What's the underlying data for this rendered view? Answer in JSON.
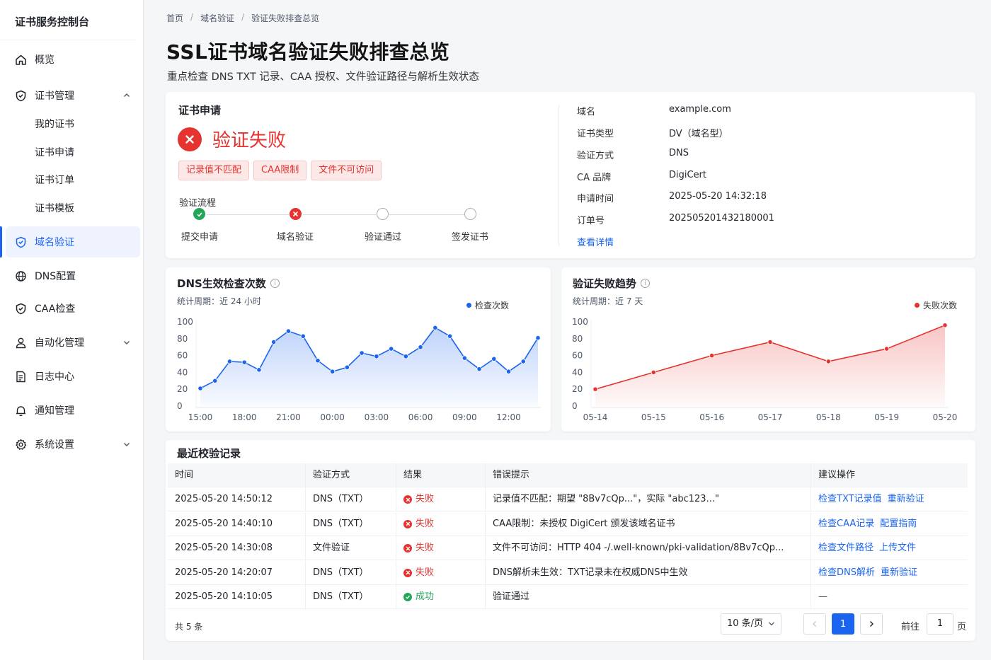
{
  "app": {
    "brand": "证书服务控制台"
  },
  "sidebar": {
    "items": [
      {
        "label": "概览",
        "icon": "home-icon"
      },
      {
        "label": "证书管理",
        "icon": "shield-check-icon"
      },
      {
        "label": "域名验证",
        "icon": "shield-check-icon"
      },
      {
        "label": "DNS配置",
        "icon": "globe-icon"
      },
      {
        "label": "CAA检查",
        "icon": "shield-icon"
      },
      {
        "label": "自动化管理",
        "icon": "user-icon"
      },
      {
        "label": "日志中心",
        "icon": "log-icon"
      },
      {
        "label": "通知管理",
        "icon": "bell-icon"
      },
      {
        "label": "系统设置",
        "icon": "gear-icon"
      }
    ],
    "sub_items": [
      "我的证书",
      "证书申请",
      "证书订单",
      "证书模板"
    ],
    "active_color": "#1a64f0"
  },
  "breadcrumb": {
    "home": "首页",
    "level2": "域名验证",
    "current": "验证失败排查总览"
  },
  "page": {
    "title": "SSL证书域名验证失败排查总览",
    "subtitle": "重点检查 DNS TXT 记录、CAA 授权、文件验证路径与解析生效状态"
  },
  "application": {
    "title": "证书申请",
    "status": "验证失败",
    "status_color": "#e5332f",
    "tags": [
      "记录值不匹配",
      "CAA限制",
      "文件不可访问"
    ],
    "flow_label": "验证流程",
    "steps": [
      {
        "label": "提交申请",
        "state": "done"
      },
      {
        "label": "域名验证",
        "state": "fail"
      },
      {
        "label": "验证通过",
        "state": "wait"
      },
      {
        "label": "签发证书",
        "state": "wait"
      }
    ],
    "info": [
      {
        "key": "域名",
        "value": "example.com"
      },
      {
        "key": "证书类型",
        "value": "DV（域名型）"
      },
      {
        "key": "验证方式",
        "value": "DNS"
      },
      {
        "key": "CA 品牌",
        "value": "DigiCert"
      },
      {
        "key": "申请时间",
        "value": "2025-05-20 14:32:18"
      },
      {
        "key": "订单号",
        "value": "202505201432180001"
      }
    ],
    "detail_link": "查看详情"
  },
  "dns_card": {
    "title": "DNS生效检查次数",
    "period": "统计周期：近 24 小时",
    "info_icon": "info-icon"
  },
  "trend_card": {
    "title": "验证失败趋势",
    "period": "统计周期：近 7 天",
    "info_icon": "info-icon"
  },
  "chart_data": [
    {
      "type": "area",
      "title": "DNS生效检查次数",
      "xlabel": "",
      "ylabel": "",
      "ylim": [
        0,
        100
      ],
      "yticks": [
        0,
        20,
        40,
        60,
        80,
        100
      ],
      "xticks": [
        "15:00",
        "18:00",
        "21:00",
        "00:00",
        "03:00",
        "06:00",
        "09:00",
        "12:00"
      ],
      "color": "#1a64f0",
      "legend_position": "top-right",
      "grid": false,
      "series": [
        {
          "name": "检查次数",
          "values": [
            21,
            30,
            53,
            52,
            43,
            76,
            89,
            83,
            54,
            41,
            46,
            63,
            59,
            68,
            59,
            70,
            93,
            83,
            57,
            44,
            56,
            41,
            53,
            81
          ]
        }
      ]
    },
    {
      "type": "area",
      "title": "验证失败趋势",
      "xlabel": "",
      "ylabel": "",
      "ylim": [
        0,
        100
      ],
      "yticks": [
        0,
        20,
        40,
        60,
        80,
        100
      ],
      "categories": [
        "05-14",
        "05-15",
        "05-16",
        "05-17",
        "05-18",
        "05-19",
        "05-20"
      ],
      "color": "#e5332f",
      "legend_position": "top-right",
      "grid": false,
      "series": [
        {
          "name": "失败次数",
          "values": [
            20,
            40,
            60,
            76,
            53,
            68,
            96
          ]
        }
      ]
    }
  ],
  "records": {
    "title": "最近校验记录",
    "columns": [
      "时间",
      "验证方式",
      "结果",
      "错误提示",
      "建议操作"
    ],
    "rows": [
      {
        "time": "2025-05-20 14:50:12",
        "method": "DNS（TXT）",
        "result": "失败",
        "ok": false,
        "error": "记录值不匹配：期望 \"8Bv7cQp...\"，实际 \"abc123...\"",
        "actions": [
          "检查TXT记录值",
          "重新验证"
        ]
      },
      {
        "time": "2025-05-20 14:40:10",
        "method": "DNS（TXT）",
        "result": "失败",
        "ok": false,
        "error": "CAA限制：未授权 DigiCert 颁发该域名证书",
        "actions": [
          "检查CAA记录",
          "配置指南"
        ]
      },
      {
        "time": "2025-05-20 14:30:08",
        "method": "文件验证",
        "result": "失败",
        "ok": false,
        "error": "文件不可访问：HTTP 404 -/.well-known/pki-validation/8Bv7cQp...",
        "actions": [
          "检查文件路径",
          "上传文件"
        ]
      },
      {
        "time": "2025-05-20 14:20:07",
        "method": "DNS（TXT）",
        "result": "失败",
        "ok": false,
        "error": "DNS解析未生效：TXT记录未在权威DNS中生效",
        "actions": [
          "检查DNS解析",
          "重新验证"
        ]
      },
      {
        "time": "2025-05-20 14:10:05",
        "method": "DNS（TXT）",
        "result": "成功",
        "ok": true,
        "error": "验证通过",
        "actions": [
          "—"
        ]
      }
    ],
    "total": "共 5 条",
    "page_size": "10 条/页",
    "current_page": "1",
    "goto_prefix": "前往",
    "goto_value": "1",
    "goto_suffix": "页",
    "fail_color": "#e5332f",
    "ok_color": "#24a659"
  }
}
